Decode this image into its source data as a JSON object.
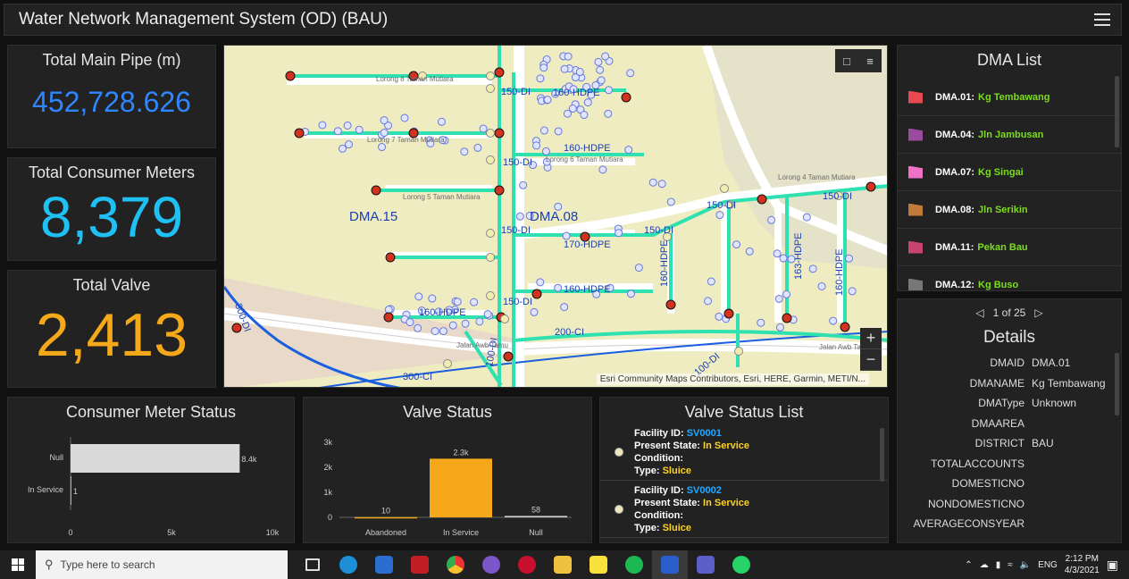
{
  "header": {
    "title": "Water Network Management System (OD) (BAU)"
  },
  "stats": {
    "pipe": {
      "title": "Total Main Pipe (m)",
      "value": "452,728.626",
      "color": "#2f86ff"
    },
    "meters": {
      "title": "Total Consumer Meters",
      "value": "8,379",
      "color": "#1fc1f5"
    },
    "valve": {
      "title": "Total Valve",
      "value": "2,413",
      "color": "#f5a81a"
    }
  },
  "map": {
    "labels": {
      "dma15": "DMA.15",
      "dma08": "DMA.08",
      "pipe1": "150-DI",
      "pipe2": "160-HDPE",
      "pipe3": "160-HDPE",
      "pipe4": "150-DI",
      "pipe5": "150-DI",
      "pipe6": "170-HDPE",
      "pipe7": "150-DI",
      "pipe8": "150-DI",
      "pipe9": "160-HDPE",
      "pipe10": "160-HDPE",
      "pipe11": "150-DI",
      "pipe12": "200-CI",
      "pipe13": "300-CI",
      "pipe14": "300-DI",
      "pipe15": "100-DI",
      "pipe16": "100-DI",
      "pipe17": "160-HDPE",
      "pipe18": "163-HDPE",
      "pipe19": "160-HDPE",
      "pipe20": "150-DI",
      "road1": "Lorong 4 Taman Mutiara",
      "road2": "Lorong 5 Taman Mutiara",
      "road3": "Lorong 6 Taman Mutiara",
      "road4": "Lorong 7 Taman Mutiara",
      "road5": "Jalan Awb Tamu",
      "road6": "Jalan Awb Tamu",
      "road7": "Lorong 8 Taman Mutiara"
    },
    "attribution": "Esri Community Maps Contributors, Esri, HERE, Garmin, METI/N...",
    "zoom_in": "+",
    "zoom_out": "−",
    "icons": {
      "bookmark": "bookmark-icon",
      "legend": "legend-icon"
    }
  },
  "dma_list": {
    "title": "DMA List",
    "items": [
      {
        "code": "DMA.01:",
        "name": "Kg Tembawang",
        "color": "#e8484f"
      },
      {
        "code": "DMA.04:",
        "name": "Jln Jambusan",
        "color": "#9a4ba0"
      },
      {
        "code": "DMA.07:",
        "name": "Kg Singai",
        "color": "#ee73c8"
      },
      {
        "code": "DMA.08:",
        "name": "Jln Serikin",
        "color": "#c07a3a"
      },
      {
        "code": "DMA.11:",
        "name": "Pekan Bau",
        "color": "#c8446f"
      },
      {
        "code": "DMA.12:",
        "name": "Kg Buso",
        "color": "#777777"
      }
    ]
  },
  "details": {
    "pager": "1 of 25",
    "title": "Details",
    "rows": [
      {
        "key": "DMAID",
        "value": "DMA.01"
      },
      {
        "key": "DMANAME",
        "value": "Kg Tembawang"
      },
      {
        "key": "DMAType",
        "value": "Unknown"
      },
      {
        "key": "DMAAREA",
        "value": ""
      },
      {
        "key": "DISTRICT",
        "value": "BAU"
      },
      {
        "key": "TOTALACCOUNTS",
        "value": ""
      },
      {
        "key": "DOMESTICNO",
        "value": ""
      },
      {
        "key": "NONDOMESTICNO",
        "value": ""
      },
      {
        "key": "AVERAGECONSYEAR",
        "value": ""
      }
    ]
  },
  "consumer_meter_status": {
    "title": "Consumer Meter Status",
    "chart_data": {
      "type": "bar",
      "orientation": "horizontal",
      "categories": [
        "Null",
        "In Service"
      ],
      "values": [
        8378,
        1
      ],
      "data_labels": [
        "8.4k",
        "1"
      ],
      "xlim": [
        0,
        10000
      ],
      "xticks": [
        "0",
        "5k",
        "10k"
      ],
      "bar_color": "#d9d9d9",
      "grid": false
    }
  },
  "valve_status": {
    "title": "Valve Status",
    "chart_data": {
      "type": "bar",
      "categories": [
        "Abandoned",
        "In Service",
        "Null"
      ],
      "values": [
        10,
        2345,
        58
      ],
      "data_labels": [
        "10",
        "2.3k",
        "58"
      ],
      "ylim": [
        0,
        3000
      ],
      "yticks": [
        "0",
        "1k",
        "2k",
        "3k"
      ],
      "bar_colors": [
        "#f5a81a",
        "#f5a81a",
        "#cfcfcf"
      ],
      "grid": false
    }
  },
  "valve_status_list": {
    "title": "Valve Status List",
    "items": [
      {
        "facility_label": "Facility ID:",
        "facility_id": "SV0001",
        "state_label": "Present State:",
        "state": "In Service",
        "condition_label": "Condition:",
        "type_label": "Type:",
        "type": "Sluice"
      },
      {
        "facility_label": "Facility ID:",
        "facility_id": "SV0002",
        "state_label": "Present State:",
        "state": "In Service",
        "condition_label": "Condition:",
        "type_label": "Type:",
        "type": "Sluice"
      }
    ]
  },
  "taskbar": {
    "search_placeholder": "Type here to search",
    "time": "2:12 PM",
    "date": "4/3/2021",
    "lang": "ENG"
  }
}
